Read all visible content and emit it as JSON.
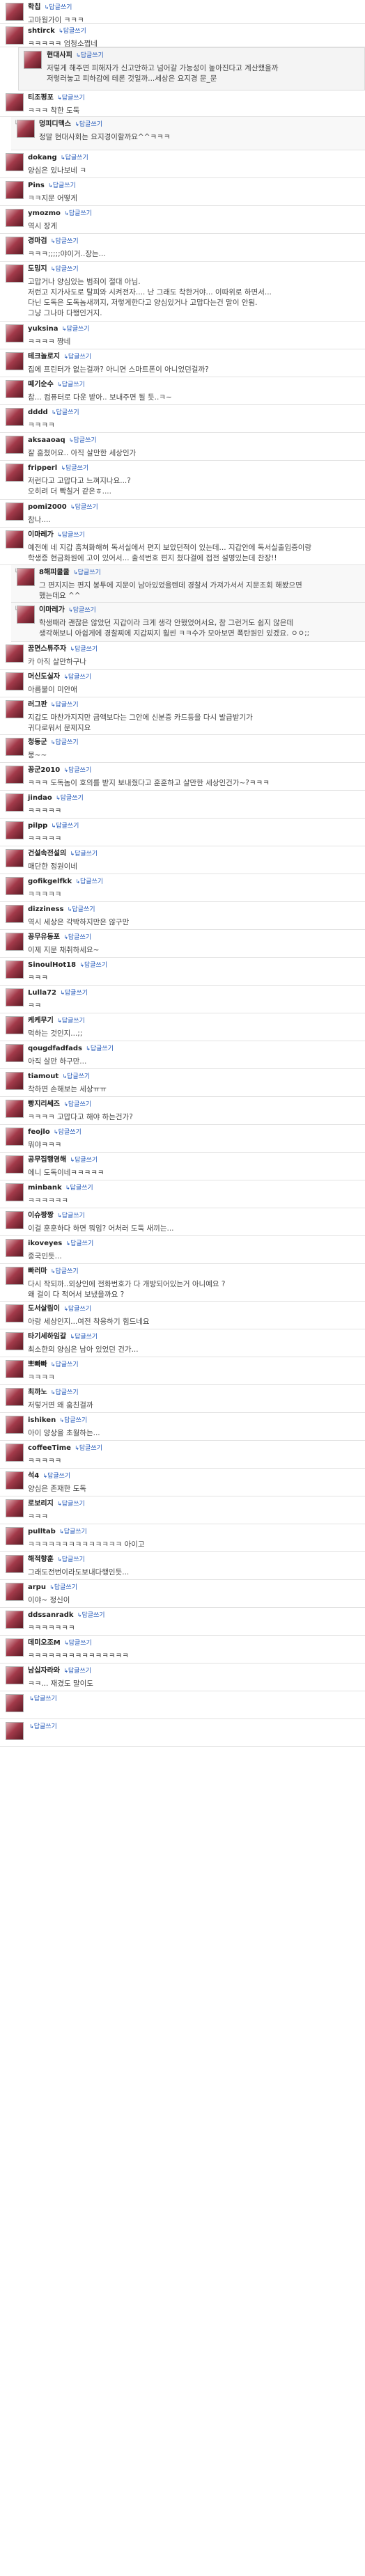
{
  "reply_label": "답글쓰기",
  "comments": [
    {
      "nick": "학칩",
      "body": "고마웡가이 ㅋㅋㅋ"
    },
    {
      "nick": "shtirck",
      "body": "ㅋㅋㅋㅋㅋ 엄청소쩝네"
    },
    {
      "nick": "현대사피",
      "body": "저렇게 해주면 피해자가 신고안하고 넘어갈 가능성이 높아진다고 계산했을까\n저렇러놓고 피하감에 테론 것일까...세상은 요지경 문_문",
      "style": "reply-box"
    },
    {
      "nick": "티조평포",
      "body": "ㅋㅋㅋ 착한 도둑"
    },
    {
      "nick": "멍피디맥스",
      "body": "정말 현대사회는 요지경이할까요^^ㅋㅋㅋ",
      "style": "nested"
    },
    {
      "nick": "dokang",
      "body": "양심은 있나보네 ㅋ"
    },
    {
      "nick": "Pins",
      "body": "ㅋㅋ지문 어떻게"
    },
    {
      "nick": "ymozmo",
      "body": "역시 장게"
    },
    {
      "nick": "경마검",
      "body": "ㅋㅋㅋ;;;;;야이거..장는..."
    },
    {
      "nick": "도밍지",
      "body": "고맙거나 양심있는 범죄이 절대 아님.\n저런고 지가사도로 탈피와 시켜전자.... 난 그래도 착한거야... 이따위로 하면서...\n다닌 도독은 도독놈새끼지, 저렇게한다고 양심있거나 고맙다는건 말이 안됨.\n그냥 그나마 다행인거지."
    },
    {
      "nick": "yuksina",
      "body": "ㅋㅋㅋㅋ 쨩네"
    },
    {
      "nick": "테크놀로지",
      "body": "집에 프린터가 없는걸까? 아니면 스마트폰이 아니었던걸까?"
    },
    {
      "nick": "떼기순수",
      "body": "참... 컴퓨터로 다운 받아.. 보내주면 될 듯..ㅋ~"
    },
    {
      "nick": "dddd",
      "body": "ㅋㅋㅋㅋ"
    },
    {
      "nick": "aksaaoaq",
      "body": "잘 훔쳤어요.. 아직 살만한 세상인가"
    },
    {
      "nick": "fripperl",
      "body": "저런다고 고맙다고 느껴지나요...?\n오히려 더 빡칠거 같은ㅎ...."
    },
    {
      "nick": "pomi2000",
      "body": "참나...."
    },
    {
      "nick": "이마레가",
      "body": "예전에 네 지갑 훔쳐화해허 독서실에서 편지 보았던적이 있는데... 지갑안에 독서실출입증이랑\n학생증 현금화원에 고이 있어서... 출석번호 편지 쳤다걸에 접전 설명있는데 찬장!!"
    },
    {
      "nick": "8해피쿨쿨",
      "body": "그 편지지는 편지 봉투에 지문이 남아있었을텐데 경찰서 가져가서서 지문조회 해봤으면\n했는데요 ^^",
      "style": "nested"
    },
    {
      "nick": "이마레가",
      "body": "학생때라 괜찮은 않았던 지갑이라 크게 생각 안했었어서요, 참 그런거도 쉽지 않은데\n생각해보니 아쉽게에 경찰찌에 지갑찌지 훨씬 ㅋㅋ수가 모아보면 폭탄원인 있겠요. ㅇㅇ;;",
      "style": "nested"
    },
    {
      "nick": "꿈면스튜주자",
      "body": "카 아직 살만하구나"
    },
    {
      "nick": "머신도실자",
      "body": "아름불이 미안애"
    },
    {
      "nick": "러그판",
      "body": "지갑도 마찬가지지만 금액보다는 그안에 신분증 카드등을 다시 발급받기가\n귀다로워서 문제지요"
    },
    {
      "nick": "청동군",
      "body": "뭉~~"
    },
    {
      "nick": "꽁군2010",
      "body": "ㅋㅋㅋ 도독놈이 호의를 받지 보내줬다고 훈훈하고 살만한 세상인건가~?ㅋㅋㅋ"
    },
    {
      "nick": "jindao",
      "body": "ㅋㅋㅋㅋㅋ"
    },
    {
      "nick": "pilpp",
      "body": "ㅋㅋㅋㅋㅋ"
    },
    {
      "nick": "건설속전설의",
      "body": "매단한 정원이네"
    },
    {
      "nick": "gofikgelfkk",
      "body": "ㅋㅋㅋㅋㅋ"
    },
    {
      "nick": "dizziness",
      "body": "역시 세상은 각박하지만은 않구만"
    },
    {
      "nick": "꽁무유동포",
      "body": "이제 지문 채취하세요~"
    },
    {
      "nick": "SinoulHot18",
      "body": "ㅋㅋㅋ"
    },
    {
      "nick": "Lulla72",
      "body": "ㅋㅋ"
    },
    {
      "nick": "케케무기",
      "body": "먹하는 것인지...;;"
    },
    {
      "nick": "qougdfadfads",
      "body": "아직 살만 하구만..."
    },
    {
      "nick": "tiamout",
      "body": "착하면 손해보는 세상ㅠㅠ"
    },
    {
      "nick": "빵지리쎄즈",
      "body": "ㅋㅋㅋㅋ 고맙다고 해야 하는건가?"
    },
    {
      "nick": "feojlo",
      "body": "뭐야ㅋㅋㅋ"
    },
    {
      "nick": "공무집행영해",
      "body": "에니 도독이네ㅋㅋㅋㅋㅋ"
    },
    {
      "nick": "minbank",
      "body": "ㅋㅋㅋㅋㅋㅋ"
    },
    {
      "nick": "이슈짱짱",
      "body": "이걸 훈훈하다 하면 뭐임? 어처러 도둑 새끼는..."
    },
    {
      "nick": "ikoveyes",
      "body": "중국인듯..."
    },
    {
      "nick": "빠러마",
      "body": "다시 작되까..외상인에 전화번호가 다 개방되어있는거 아니예요 ?\n왜 걸이 다 적어서 보냈을까요 ?"
    },
    {
      "nick": "도서살림이",
      "body": "아랑 세상인지...여전 착응하기 힘드네요"
    },
    {
      "nick": "타기세하임갈",
      "body": "최소한의 양심은 남아 있었던 건가..."
    },
    {
      "nick": "뽀빠빠",
      "body": "ㅋㅋㅋㅋ"
    },
    {
      "nick": "최까노",
      "body": "저렇거면 왜 훔친걸까"
    },
    {
      "nick": "ishiken",
      "body": "아이 양상을 초월하는..."
    },
    {
      "nick": "coffeeTime",
      "body": "ㅋㅋㅋㅋㅋ"
    },
    {
      "nick": "석4",
      "body": "양심은 존재한 도독"
    },
    {
      "nick": "로보리지",
      "body": "ㅋㅋㅋ"
    },
    {
      "nick": "pulltab",
      "body": "ㅋㅋㅋㅋㅋㅋㅋㅋㅋㅋㅋㅋㅋㅋ 아이고"
    },
    {
      "nick": "해적향훈",
      "body": "그래도전번이라도보내다행인듯..."
    },
    {
      "nick": "arpu",
      "body": "이야~ 정신이"
    },
    {
      "nick": "ddssanradk",
      "body": "ㅋㅋㅋㅋㅋㅋㅋ"
    },
    {
      "nick": "데미오조M",
      "body": "ㅋㅋㅋㅋㅋㅋㅋㅋㅋㅋㅋㅋㅋㅋㅋ"
    },
    {
      "nick": "남십자라와",
      "body": "ㅋㅋ... 재겼도 말이도"
    }
  ]
}
